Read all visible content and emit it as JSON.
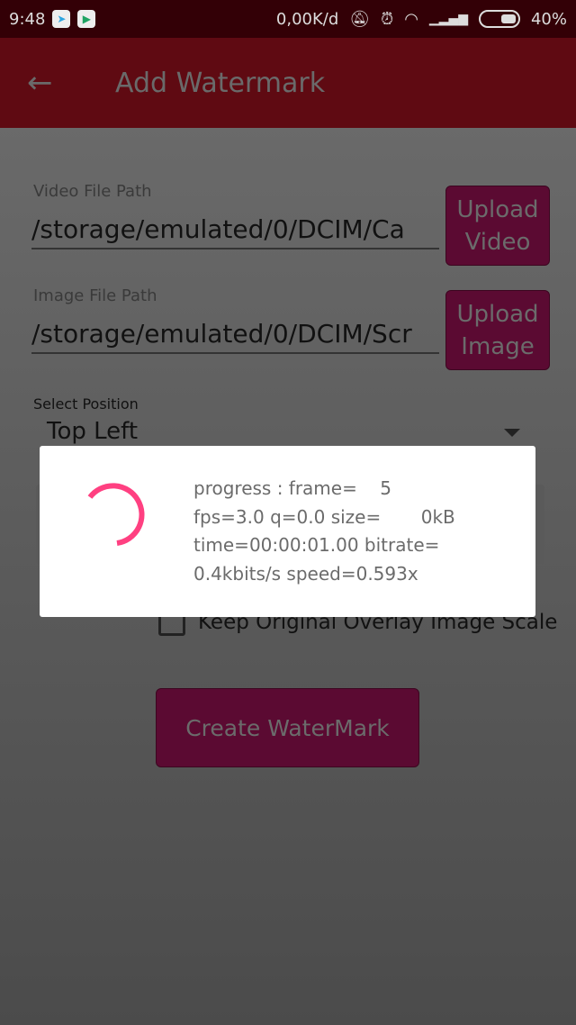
{
  "status_bar": {
    "time": "9:48",
    "network_speed": "0,00K/d",
    "battery": "40%",
    "icons": [
      "telegram-icon",
      "play-store-icon",
      "mute-icon",
      "alarm-icon",
      "wifi-icon",
      "signal-icon",
      "battery-icon"
    ]
  },
  "toolbar": {
    "title": "Add Watermark",
    "back_icon": "arrow-left-icon"
  },
  "form": {
    "video_label": "Video File Path",
    "video_value": "/storage/emulated/0/DCIM/Ca",
    "upload_video": "Upload\nVideo",
    "image_label": "Image File Path",
    "image_value": "/storage/emulated/0/DCIM/Scr",
    "upload_image": "Upload\nImage",
    "position_label": "Select Position",
    "position_value": "Top Left",
    "keep_scale_label": "Keep Original Overlay Image Scale",
    "keep_scale_checked": false,
    "create_button": "Create WaterMark"
  },
  "dialog": {
    "message": "progress : frame=    5\nfps=3.0 q=0.0 size=       0kB\ntime=00:00:01.00 bitrate=\n0.4kbits/s speed=0.593x",
    "spinner_color": "#ff4081"
  },
  "colors": {
    "primary": "#5f0a12",
    "status_bar": "#330006",
    "button": "#8e0f4e"
  }
}
